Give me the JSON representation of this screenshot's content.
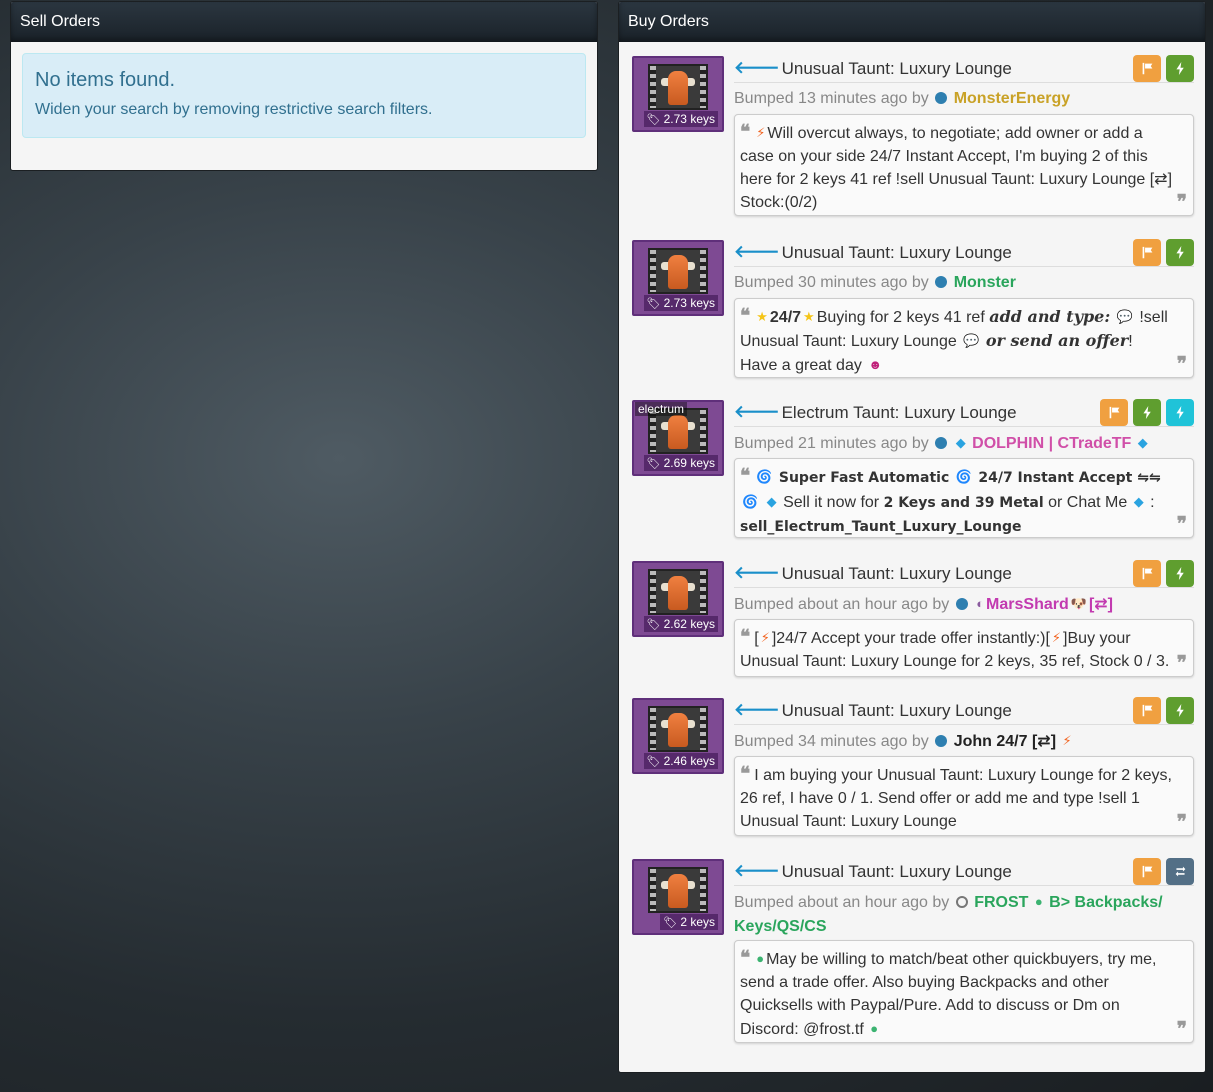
{
  "sell_panel": {
    "title": "Sell Orders",
    "alert_title": "No items found.",
    "alert_text": "Widen your search by removing restrictive search filters."
  },
  "buy_panel": {
    "title": "Buy Orders",
    "orders": [
      {
        "item": "Unusual Taunt: Luxury Lounge",
        "price": "2.73 keys",
        "bumped": "Bumped 13 minutes ago by",
        "user": "MonsterEnergy",
        "user_color": "#c9a227",
        "message": "Will overcut always, to negotiate; add owner or add a case on your side 24/7 Instant Accept, I'm buying 2 of this here for 2 keys 41 ref !sell Unusual Taunt: Luxury Lounge [⇄] Stock:(0/2)"
      },
      {
        "item": "Unusual Taunt: Luxury Lounge",
        "price": "2.73 keys",
        "bumped": "Bumped 30 minutes ago by",
        "user": "Monster",
        "user_color": "#2aa55c",
        "message_a": "24/7",
        "message_b": "Buying for 2 keys 41 ref",
        "message_c": "add and type:",
        "message_d": "!sell Unusual Taunt: Luxury Lounge",
        "message_e": "or send an offer",
        "message_f": "! Have a great day"
      },
      {
        "item": "Electrum Taunt: Luxury Lounge",
        "price": "2.69 keys",
        "effect": "electrum",
        "bumped": "Bumped 21 minutes ago by",
        "user": "DOLPHIN | CTradeTF",
        "user_color": "#d04fa8",
        "message_a": "Super Fast Automatic",
        "message_b": "24/7 Instant Accept ⇋⇋",
        "message_c": "Sell it now for",
        "message_d": "2 Keys and 39 Metal",
        "message_e": "or Chat Me",
        "message_f": "sell_Electrum_Taunt_Luxury_Lounge"
      },
      {
        "item": "Unusual Taunt: Luxury Lounge",
        "price": "2.62 keys",
        "bumped": "Bumped about an hour ago by",
        "user": "MarsShard",
        "user_suffix": "[⇄]",
        "user_color": "#c23ab0",
        "message_a": "[",
        "message_b": "]24/7 Accept your trade offer instantly:)[",
        "message_c": "]Buy your Unusual Taunt: Luxury Lounge for 2 keys, 35 ref, Stock 0 / 3."
      },
      {
        "item": "Unusual Taunt: Luxury Lounge",
        "price": "2.46 keys",
        "bumped": "Bumped 34 minutes ago by",
        "user": "John 24/7 [⇄]",
        "user_color": "#222222",
        "message": "I am buying your Unusual Taunt: Luxury Lounge for 2 keys, 26 ref, I have 0 / 1. Send offer or add me and type !sell 1 Unusual Taunt: Luxury Lounge"
      },
      {
        "item": "Unusual Taunt: Luxury Lounge",
        "price": "2 keys",
        "bumped": "Bumped about an hour ago by",
        "user": "FROST",
        "user_suffix": "B> Backpacks/ Keys/QS/CS",
        "user_color": "#2aa55c",
        "message": "May be willing to match/beat other quickbuyers, try me, send a trade offer. Also buying Backpacks and other Quicksells with Paypal/Pure. Add to discuss or Dm on Discord: @frost.tf"
      }
    ]
  },
  "icons": {
    "flag": "flag-icon",
    "bolt": "bolt-icon",
    "swap": "swap-icon",
    "tag": "price-tag-icon",
    "arrow": "arrow-left-icon",
    "quote_open": "quote-left-icon",
    "quote_close": "quote-right-icon"
  },
  "colors": {
    "flag_button": "#f0a040",
    "bolt_button": "#5f9e2f",
    "cyan_button": "#1fc3d8",
    "swap_button": "#536f86",
    "thumb_bg": "#7e4a93",
    "alert_bg": "#d9edf7",
    "alert_text": "#31708f"
  }
}
